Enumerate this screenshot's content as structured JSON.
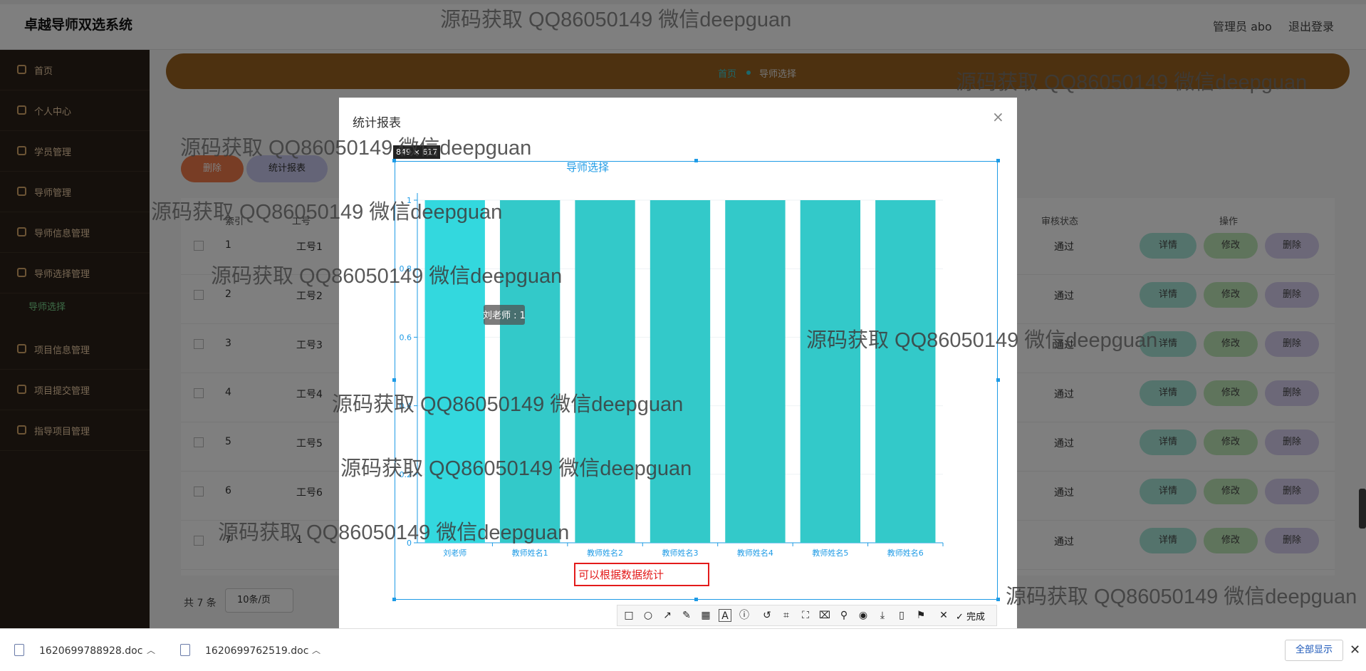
{
  "app": {
    "title": "卓越导师双选系统",
    "admin_label": "管理员 abo",
    "logout": "退出登录"
  },
  "sidebar": {
    "items": [
      {
        "label": "首页"
      },
      {
        "label": "个人中心"
      },
      {
        "label": "学员管理"
      },
      {
        "label": "导师管理"
      },
      {
        "label": "导师信息管理"
      },
      {
        "label": "导师选择管理"
      },
      {
        "label": "项目信息管理"
      },
      {
        "label": "项目提交管理"
      },
      {
        "label": "指导项目管理"
      }
    ],
    "sub_active": "导师选择"
  },
  "breadcrumb": {
    "home": "首页",
    "current": "导师选择"
  },
  "actions": {
    "delete": "删除",
    "report": "统计报表"
  },
  "table": {
    "headers": {
      "index": "索引",
      "number": "工号",
      "status": "审核状态",
      "ops": "操作"
    },
    "rows": [
      {
        "index": "1",
        "number": "工号1",
        "status": "通过"
      },
      {
        "index": "2",
        "number": "工号2",
        "status": "通过"
      },
      {
        "index": "3",
        "number": "工号3",
        "status": "通过"
      },
      {
        "index": "4",
        "number": "工号4",
        "status": "通过"
      },
      {
        "index": "5",
        "number": "工号5",
        "status": "通过"
      },
      {
        "index": "6",
        "number": "工号6",
        "status": "通过"
      },
      {
        "index": "7",
        "number": "1",
        "status": "通过"
      }
    ],
    "op_labels": {
      "detail": "详情",
      "edit": "修改",
      "remove": "删除"
    }
  },
  "pager": {
    "total": "共 7 条",
    "size": "10条/页"
  },
  "modal": {
    "title": "统计报表",
    "close": "×"
  },
  "capture": {
    "size_label": "849 × 617",
    "text_annotation": "可以根据数据统计"
  },
  "chart_data": {
    "type": "bar",
    "title": "导师选择",
    "categories": [
      "刘老师",
      "教师姓名1",
      "教师姓名2",
      "教师姓名3",
      "教师姓名4",
      "教师姓名5",
      "教师姓名6"
    ],
    "values": [
      1,
      1,
      1,
      1,
      1,
      1,
      1
    ],
    "ylim": [
      0,
      1
    ],
    "yticks": [
      "0",
      "0.2",
      "0.4",
      "0.6",
      "0.8",
      "1"
    ],
    "tooltip": "刘老师 : 1",
    "bar_color": "#33c9c9",
    "highlight_color": "#33d8de",
    "grid": true
  },
  "toolbar": {
    "done": "完成",
    "font_size": "12",
    "icons": [
      "rect-icon",
      "circle-icon",
      "arrow-icon",
      "pen-icon",
      "mosaic-icon",
      "text-icon",
      "serial-icon",
      "undo-icon",
      "crop-icon",
      "translate-icon",
      "ocr-icon",
      "pin-icon",
      "record-icon",
      "save-icon",
      "phone-icon",
      "bookmark-icon",
      "close-icon"
    ],
    "current_color": "#e50000",
    "colors": [
      "#000000",
      "#808080",
      "#800000",
      "#f7883a",
      "#308430",
      "#385ad3",
      "#9c0ca3",
      "#009999",
      "#ffffff",
      "#c0c0c0",
      "#fb3838",
      "#ffff00",
      "#99cc00",
      "#3894e4",
      "#f31bf3",
      "#16dcdc"
    ]
  },
  "downloads": [
    {
      "name": "1620699788928.doc"
    },
    {
      "name": "1620699762519.doc"
    }
  ],
  "downloads_showall": "全部显示",
  "watermark": "源码获取 QQ86050149 微信deepguan"
}
